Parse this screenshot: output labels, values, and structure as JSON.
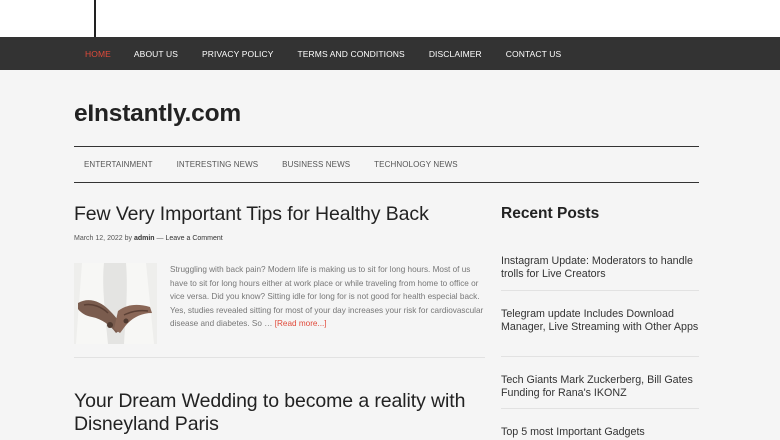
{
  "nav": {
    "items": [
      {
        "label": "HOME",
        "active": true
      },
      {
        "label": "ABOUT US",
        "active": false
      },
      {
        "label": "PRIVACY POLICY",
        "active": false
      },
      {
        "label": "TERMS AND CONDITIONS",
        "active": false
      },
      {
        "label": "DISCLAIMER",
        "active": false
      },
      {
        "label": "CONTACT US",
        "active": false
      }
    ],
    "active_color": "#e04a3a"
  },
  "site": {
    "title": "eInstantly.com"
  },
  "subnav": {
    "items": [
      "ENTERTAINMENT",
      "INTERESTING NEWS",
      "BUSINESS NEWS",
      "TECHNOLOGY NEWS"
    ]
  },
  "post1": {
    "title": "Few Very Important Tips for Healthy Back",
    "date": "March 12, 2022",
    "by": "by",
    "author": "admin",
    "dash": "—",
    "comment_link": "Leave a Comment",
    "excerpt": "Struggling with back pain? Modern life is making us to sit for long hours. Most of us have to sit for long hours either at work place or while traveling from home to office or vice versa. Did you know? Sitting idle for long for is not good for health especial back. Yes, studies revealed sitting for most of your day increases your risk for cardiovascular disease and diabetes. So …",
    "read_more": "[Read more...]"
  },
  "post2": {
    "title": "Your Dream Wedding to become a reality with Disneyland Paris"
  },
  "sidebar": {
    "heading": "Recent Posts",
    "items": [
      "Instagram Update: Moderators to handle trolls for Live Creators",
      "Telegram update Includes Download Manager, Live Streaming with Other Apps",
      "Tech Giants Mark Zuckerberg, Bill Gates Funding for Rana's IKONZ",
      "Top 5 most Important Gadgets"
    ]
  }
}
